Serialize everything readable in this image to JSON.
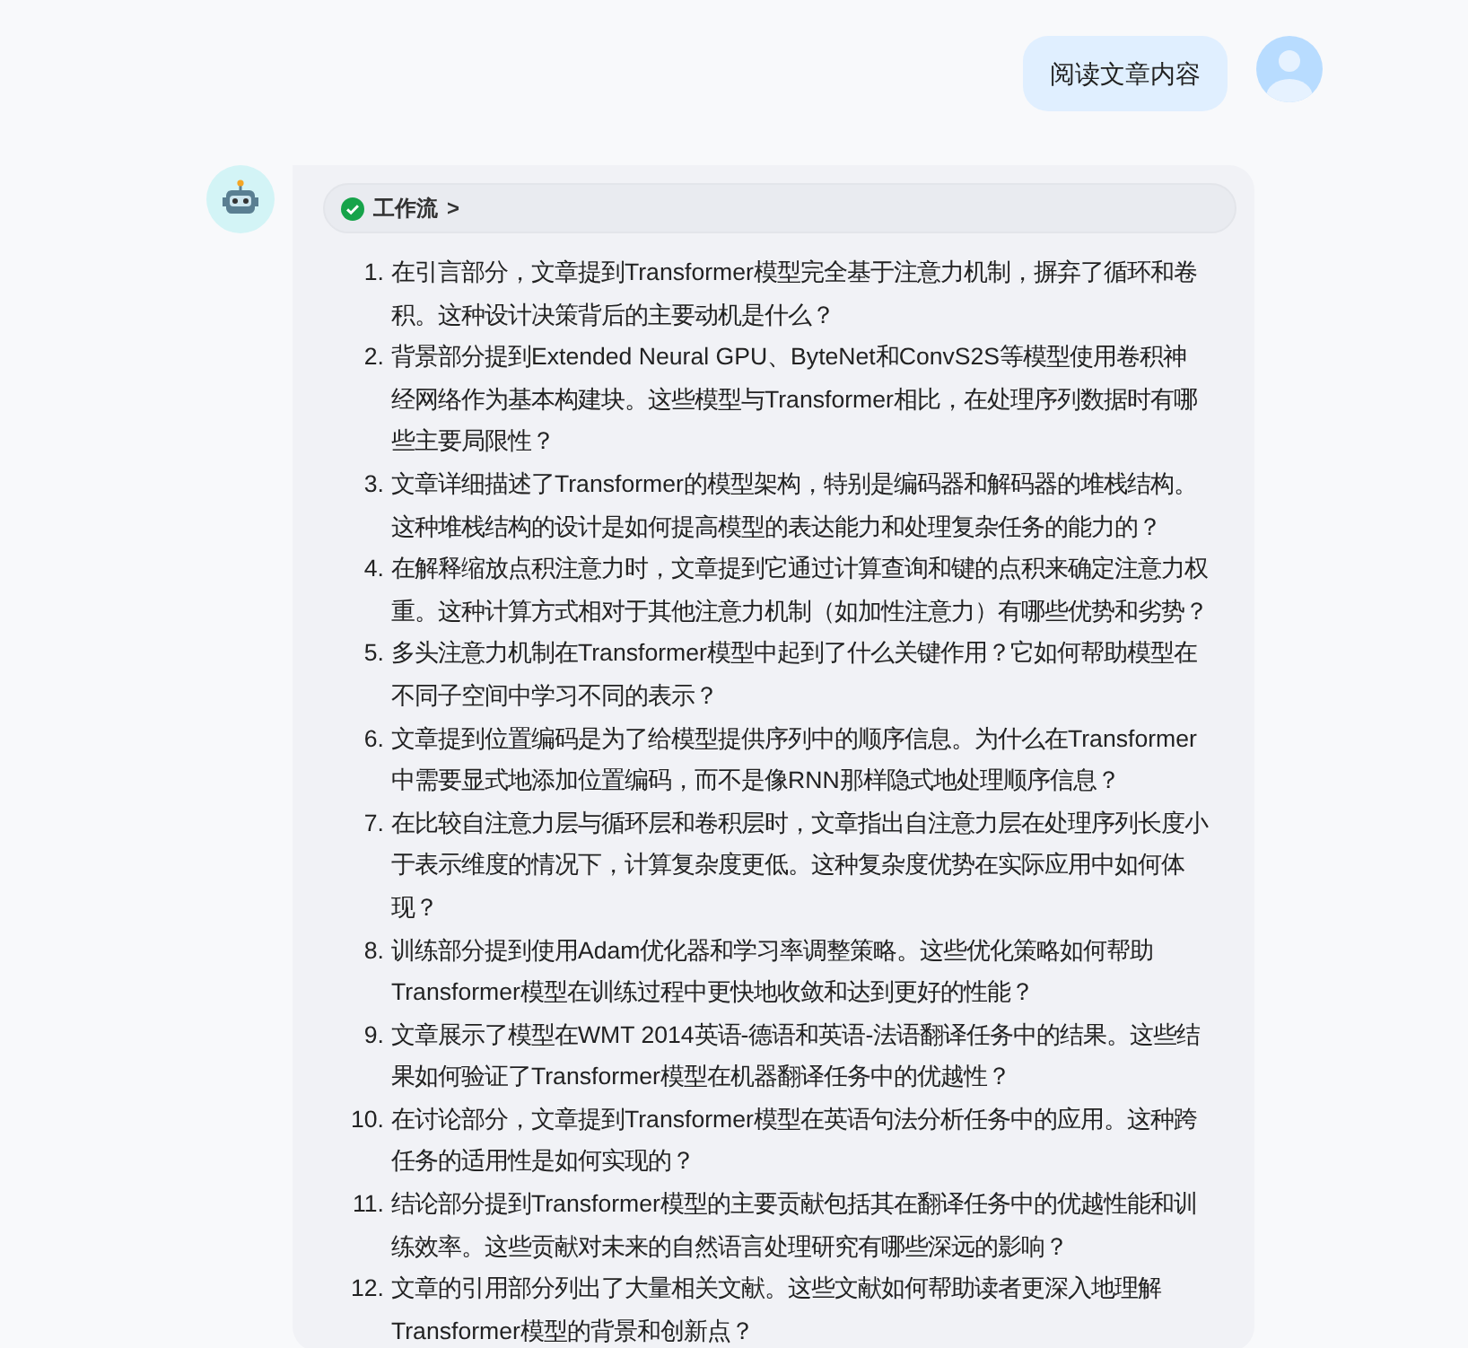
{
  "user_message": {
    "text": "阅读文章内容"
  },
  "assistant_message": {
    "workflow": {
      "label": "工作流",
      "chevron": ">",
      "done": true
    },
    "questions": [
      {
        "number": "1.",
        "text": "在引言部分，文章提到Transformer模型完全基于注意力机制，摒弃了循环和卷积。这种设计决策背后的主要动机是什么？"
      },
      {
        "number": "2.",
        "text": "背景部分提到Extended Neural GPU、ByteNet和ConvS2S等模型使用卷积神经网络作为基本构建块。这些模型与Transformer相比，在处理序列数据时有哪些主要局限性？"
      },
      {
        "number": "3.",
        "text": "文章详细描述了Transformer的模型架构，特别是编码器和解码器的堆栈结构。这种堆栈结构的设计是如何提高模型的表达能力和处理复杂任务的能力的？"
      },
      {
        "number": "4.",
        "text": "在解释缩放点积注意力时，文章提到它通过计算查询和键的点积来确定注意力权重。这种计算方式相对于其他注意力机制（如加性注意力）有哪些优势和劣势？"
      },
      {
        "number": "5.",
        "text": "多头注意力机制在Transformer模型中起到了什么关键作用？它如何帮助模型在不同子空间中学习不同的表示？"
      },
      {
        "number": "6.",
        "text": "文章提到位置编码是为了给模型提供序列中的顺序信息。为什么在Transformer中需要显式地添加位置编码，而不是像RNN那样隐式地处理顺序信息？"
      },
      {
        "number": "7.",
        "text": "在比较自注意力层与循环层和卷积层时，文章指出自注意力层在处理序列长度小于表示维度的情况下，计算复杂度更低。这种复杂度优势在实际应用中如何体现？"
      },
      {
        "number": "8.",
        "text": "训练部分提到使用Adam优化器和学习率调整策略。这些优化策略如何帮助Transformer模型在训练过程中更快地收敛和达到更好的性能？"
      },
      {
        "number": "9.",
        "text": "文章展示了模型在WMT 2014英语-德语和英语-法语翻译任务中的结果。这些结果如何验证了Transformer模型在机器翻译任务中的优越性？"
      },
      {
        "number": "10.",
        "text": "在讨论部分，文章提到Transformer模型在英语句法分析任务中的应用。这种跨任务的适用性是如何实现的？"
      },
      {
        "number": "11.",
        "text": "结论部分提到Transformer模型的主要贡献包括其在翻译任务中的优越性能和训练效率。这些贡献对未来的自然语言处理研究有哪些深远的影响？"
      },
      {
        "number": "12.",
        "text": "文章的引用部分列出了大量相关文献。这些文献如何帮助读者更深入地理解Transformer模型的背景和创新点？"
      }
    ]
  }
}
